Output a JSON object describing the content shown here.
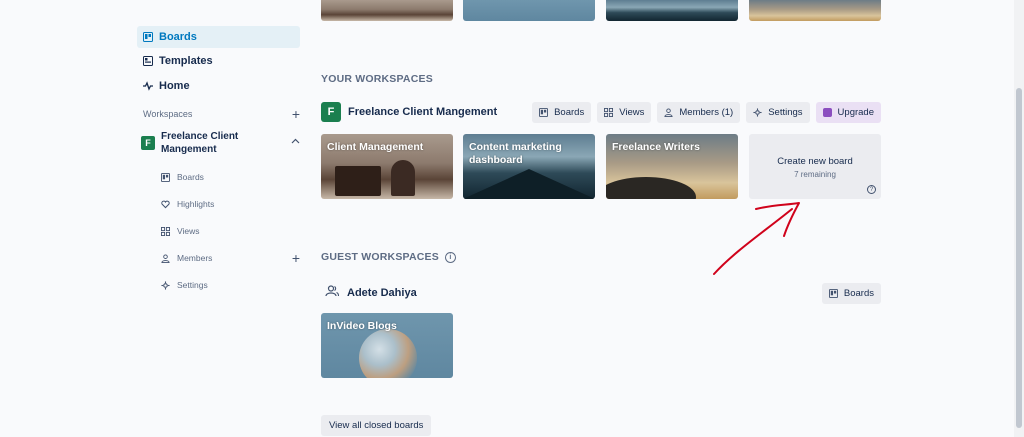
{
  "sidebar": {
    "nav": [
      {
        "label": "Boards",
        "icon": "board-icon",
        "active": true
      },
      {
        "label": "Templates",
        "icon": "template-icon",
        "active": false
      },
      {
        "label": "Home",
        "icon": "activity-icon",
        "active": false
      }
    ],
    "workspaces_heading": "Workspaces",
    "workspace": {
      "badge": "F",
      "name": "Freelance Client Mangement"
    },
    "sub_items": [
      {
        "label": "Boards",
        "icon": "board-icon"
      },
      {
        "label": "Highlights",
        "icon": "heart-icon"
      },
      {
        "label": "Views",
        "icon": "grid-icon"
      },
      {
        "label": "Members",
        "icon": "members-icon"
      },
      {
        "label": "Settings",
        "icon": "gear-icon"
      }
    ]
  },
  "main": {
    "your_workspaces_title": "YOUR WORKSPACES",
    "workspace": {
      "badge": "F",
      "name": "Freelance Client Mangement",
      "actions": [
        {
          "label": "Boards",
          "icon": "board-icon"
        },
        {
          "label": "Views",
          "icon": "grid-icon"
        },
        {
          "label": "Members (1)",
          "icon": "members-icon"
        },
        {
          "label": "Settings",
          "icon": "gear-icon"
        },
        {
          "label": "Upgrade",
          "icon": "upgrade-icon"
        }
      ],
      "boards": [
        {
          "title": "Client Management"
        },
        {
          "title": "Content marketing dashboard"
        },
        {
          "title": "Freelance Writers"
        }
      ],
      "create_board": {
        "label": "Create new board",
        "sub": "7 remaining"
      }
    },
    "guest_workspaces_title": "GUEST WORKSPACES",
    "guest": {
      "name": "Adete Dahiya",
      "boards_button": "Boards",
      "boards": [
        {
          "title": "InVideo Blogs"
        }
      ]
    },
    "view_closed_label": "View all closed boards"
  },
  "colors": {
    "accent": "#0079bf",
    "workspace_badge": "#1b7f4f",
    "annotation": "#d0021b"
  }
}
